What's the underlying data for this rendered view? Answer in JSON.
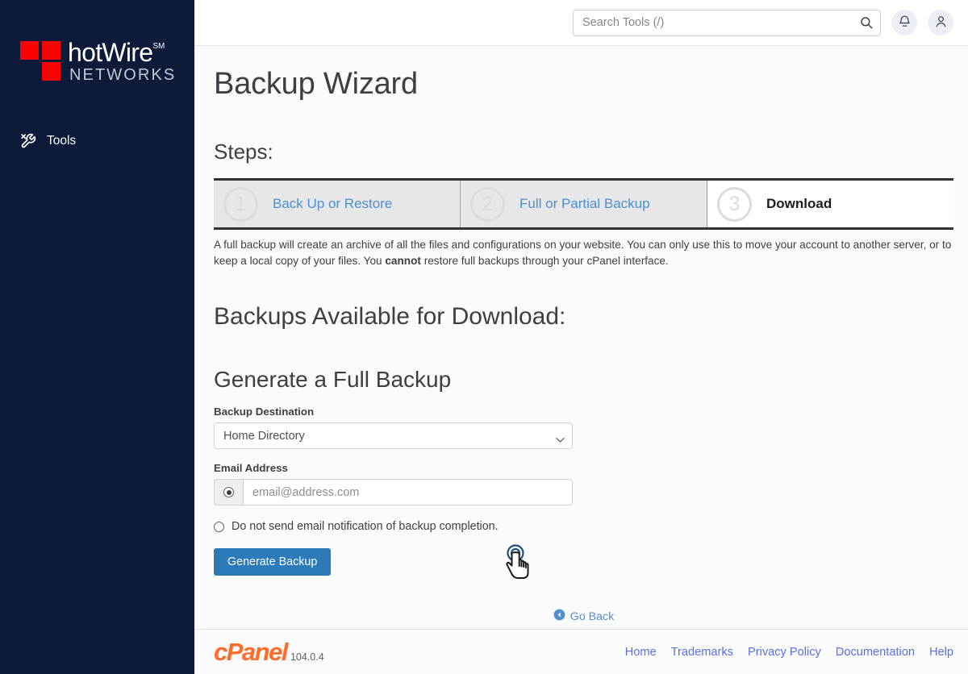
{
  "sidebar": {
    "logo": {
      "name_main": "hotWire",
      "name_mark": "SM",
      "name_sub": "NETWORKS",
      "square_color": "#fa0000",
      "background": "#0d1a3a"
    },
    "items": [
      {
        "label": "Tools",
        "icon": "tools-icon"
      }
    ]
  },
  "header": {
    "search": {
      "placeholder": "Search Tools (/)",
      "value": "",
      "icon": "search-icon"
    },
    "buttons": [
      {
        "name": "notifications-button",
        "icon": "bell-icon"
      },
      {
        "name": "account-button",
        "icon": "user-icon"
      }
    ]
  },
  "main": {
    "page_title": "Backup Wizard",
    "steps_heading": "Steps:",
    "steps": [
      {
        "number": "1",
        "label": "Back Up or Restore",
        "active": false
      },
      {
        "number": "2",
        "label": "Full or Partial Backup",
        "active": false
      },
      {
        "number": "3",
        "label": "Download",
        "active": true
      }
    ],
    "description_part1": "A full backup will create an archive of all the files and configurations on your website. You can only use this to move your account to another server, or to keep a local copy of your files. You ",
    "description_bold": "cannot",
    "description_part2": " restore full backups through your cPanel interface.",
    "section_title": "Backups Available for Download:",
    "form": {
      "title": "Generate a Full Backup",
      "destination_label": "Backup Destination",
      "destination_value": "Home Directory",
      "destination_options": [
        "Home Directory"
      ],
      "email_label": "Email Address",
      "email_placeholder": "email@address.com",
      "email_value": "",
      "email_radio_checked": true,
      "no_email_label": "Do not send email notification of backup completion.",
      "no_email_radio_checked": false,
      "submit_label": "Generate Backup",
      "submit_color": "#2c7ab8"
    },
    "go_back_label": "Go Back",
    "go_back_icon": "arrow-circle-left-icon"
  },
  "footer": {
    "brand": "cPanel",
    "version": "104.0.4",
    "brand_color": "#ff6c2c",
    "links": [
      "Home",
      "Trademarks",
      "Privacy Policy",
      "Documentation",
      "Help"
    ]
  }
}
